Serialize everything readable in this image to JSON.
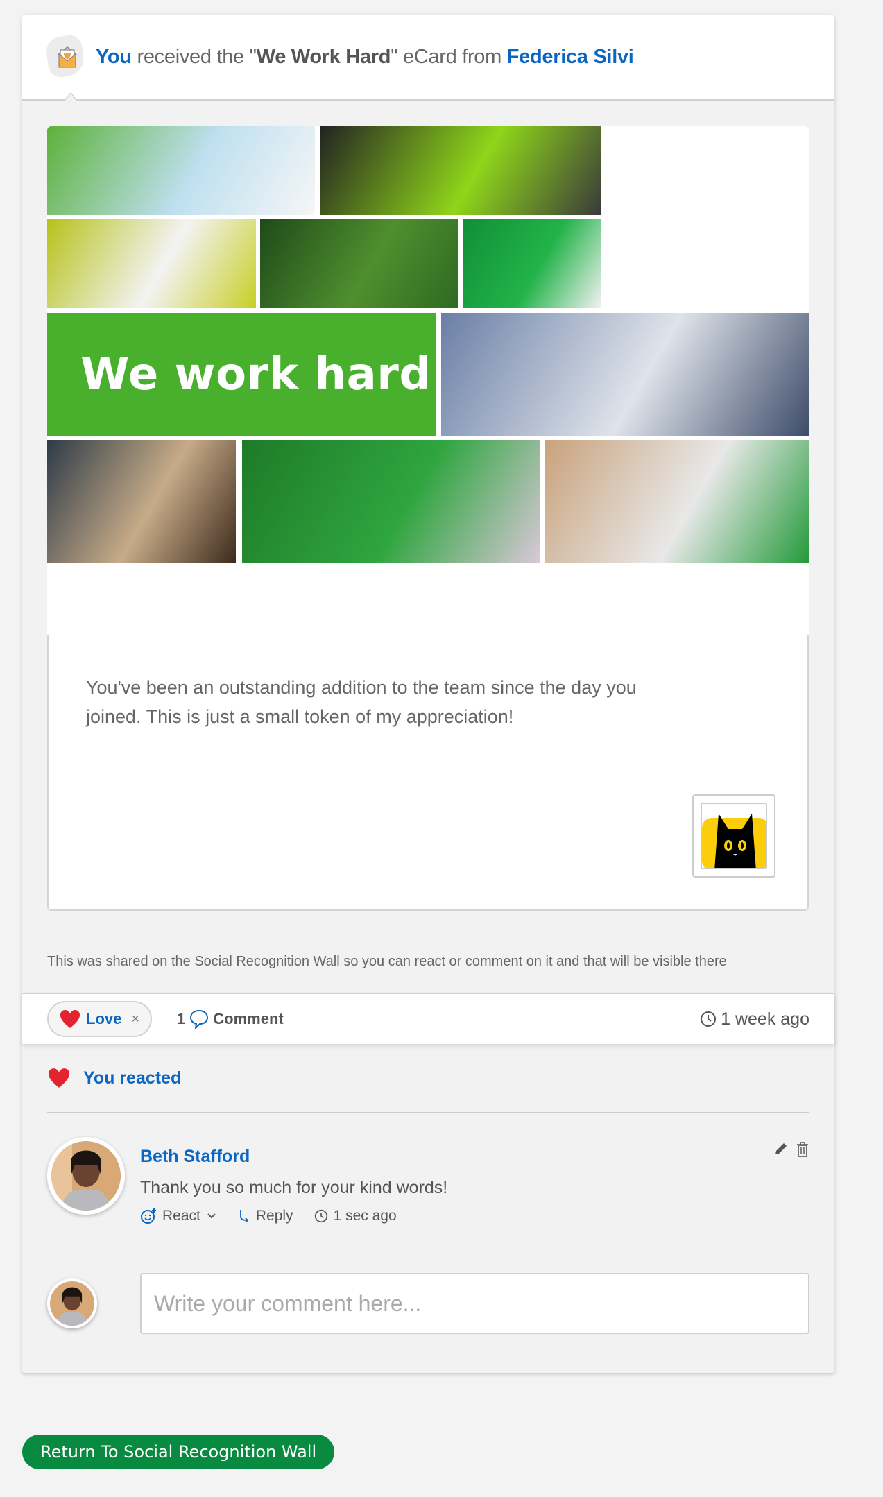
{
  "header": {
    "subject": "You",
    "text_before": " received the \"",
    "card_name": "We Work Hard",
    "text_after": "\" eCard from ",
    "sender": "Federica Silvi",
    "icon": "envelope-heart-icon"
  },
  "ecard": {
    "banner_text": "We work hard",
    "photos": [
      {
        "name": "woman-writing-whiteboard",
        "colors": [
          "#5db13a",
          "#bfe0f0",
          "#f6f6f6"
        ]
      },
      {
        "name": "man-at-desk-headphones",
        "colors": [
          "#222",
          "#8fd61a",
          "#3a3a3a"
        ]
      },
      {
        "name": "overhead-team-meeting",
        "colors": [
          "#b6c21a",
          "#f3f3f3",
          "#c7cf25"
        ]
      },
      {
        "name": "office-with-plants",
        "colors": [
          "#1f4a1a",
          "#4f8f2e",
          "#2d6a22"
        ]
      },
      {
        "name": "pair-working-green-booth",
        "colors": [
          "#0f8f37",
          "#23b34a",
          "#f1f1f1"
        ]
      },
      {
        "name": "open-plan-office",
        "colors": [
          "#6a7fa6",
          "#dfe3ea",
          "#3d4c6a"
        ]
      },
      {
        "name": "dachshund-in-office",
        "colors": [
          "#2d3b47",
          "#c7ab88",
          "#3d2a1d"
        ]
      },
      {
        "name": "thinking-man",
        "colors": [
          "#1e7a28",
          "#2fa53f",
          "#d9c8d8"
        ]
      },
      {
        "name": "women-at-computers",
        "colors": [
          "#c9a27c",
          "#e8e8e8",
          "#239a3a"
        ]
      }
    ],
    "message": "You've been an outstanding addition to the team since the day you joined. This is just a small token of my appreciation!",
    "sticker": "black-cat-sticker"
  },
  "note": "This was shared on the Social Recognition Wall so you can react or comment on it and that will be visible there",
  "reactions": {
    "love_label": "Love",
    "remove_label": "×",
    "comment_count": "1",
    "comment_label": "Comment",
    "time_ago": "1 week ago"
  },
  "colors": {
    "link_blue": "#0b66c3",
    "banner_green": "#48b02d",
    "button_green": "#088a41",
    "heart_red": "#e3232d"
  },
  "comments_section": {
    "you_reacted": "You reacted",
    "comments": [
      {
        "author": "Beth Stafford",
        "text": "Thank you so much for your kind words!",
        "react_label": "React",
        "reply_label": "Reply",
        "time": "1 sec ago"
      }
    ],
    "input_placeholder": "Write your comment here..."
  },
  "footer": {
    "return_button": "Return To Social Recognition Wall"
  }
}
